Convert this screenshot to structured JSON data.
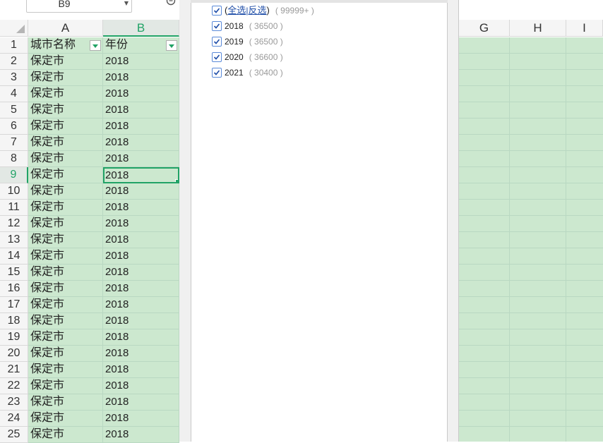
{
  "name_box": {
    "value": "B9"
  },
  "columns": {
    "A": "A",
    "B": "B",
    "G": "G",
    "H": "H",
    "I": "I"
  },
  "header_row": {
    "row_number": "1",
    "col_a": "城市名称",
    "col_b": "年份"
  },
  "rows": [
    {
      "n": "2",
      "a": "保定市",
      "b": "2018"
    },
    {
      "n": "3",
      "a": "保定市",
      "b": "2018"
    },
    {
      "n": "4",
      "a": "保定市",
      "b": "2018"
    },
    {
      "n": "5",
      "a": "保定市",
      "b": "2018"
    },
    {
      "n": "6",
      "a": "保定市",
      "b": "2018"
    },
    {
      "n": "7",
      "a": "保定市",
      "b": "2018"
    },
    {
      "n": "8",
      "a": "保定市",
      "b": "2018"
    },
    {
      "n": "9",
      "a": "保定市",
      "b": "2018"
    },
    {
      "n": "10",
      "a": "保定市",
      "b": "2018"
    },
    {
      "n": "11",
      "a": "保定市",
      "b": "2018"
    },
    {
      "n": "12",
      "a": "保定市",
      "b": "2018"
    },
    {
      "n": "13",
      "a": "保定市",
      "b": "2018"
    },
    {
      "n": "14",
      "a": "保定市",
      "b": "2018"
    },
    {
      "n": "15",
      "a": "保定市",
      "b": "2018"
    },
    {
      "n": "16",
      "a": "保定市",
      "b": "2018"
    },
    {
      "n": "17",
      "a": "保定市",
      "b": "2018"
    },
    {
      "n": "18",
      "a": "保定市",
      "b": "2018"
    },
    {
      "n": "19",
      "a": "保定市",
      "b": "2018"
    },
    {
      "n": "20",
      "a": "保定市",
      "b": "2018"
    },
    {
      "n": "21",
      "a": "保定市",
      "b": "2018"
    },
    {
      "n": "22",
      "a": "保定市",
      "b": "2018"
    },
    {
      "n": "23",
      "a": "保定市",
      "b": "2018"
    },
    {
      "n": "24",
      "a": "保定市",
      "b": "2018"
    },
    {
      "n": "25",
      "a": "保定市",
      "b": "2018"
    }
  ],
  "filter": {
    "open_paren": "(",
    "select_all": "全选",
    "separator": "|",
    "invert": "反选",
    "close_paren": ")",
    "select_all_count": "( 99999+ )",
    "items": [
      {
        "label": "2018",
        "count": "( 36500 )"
      },
      {
        "label": "2019",
        "count": "( 36500 )"
      },
      {
        "label": "2020",
        "count": "( 36600 )"
      },
      {
        "label": "2021",
        "count": "( 30400 )"
      }
    ]
  },
  "colors": {
    "accent": "#21a366",
    "cell_fill": "#cce8cf",
    "link": "#1f4ea8"
  }
}
